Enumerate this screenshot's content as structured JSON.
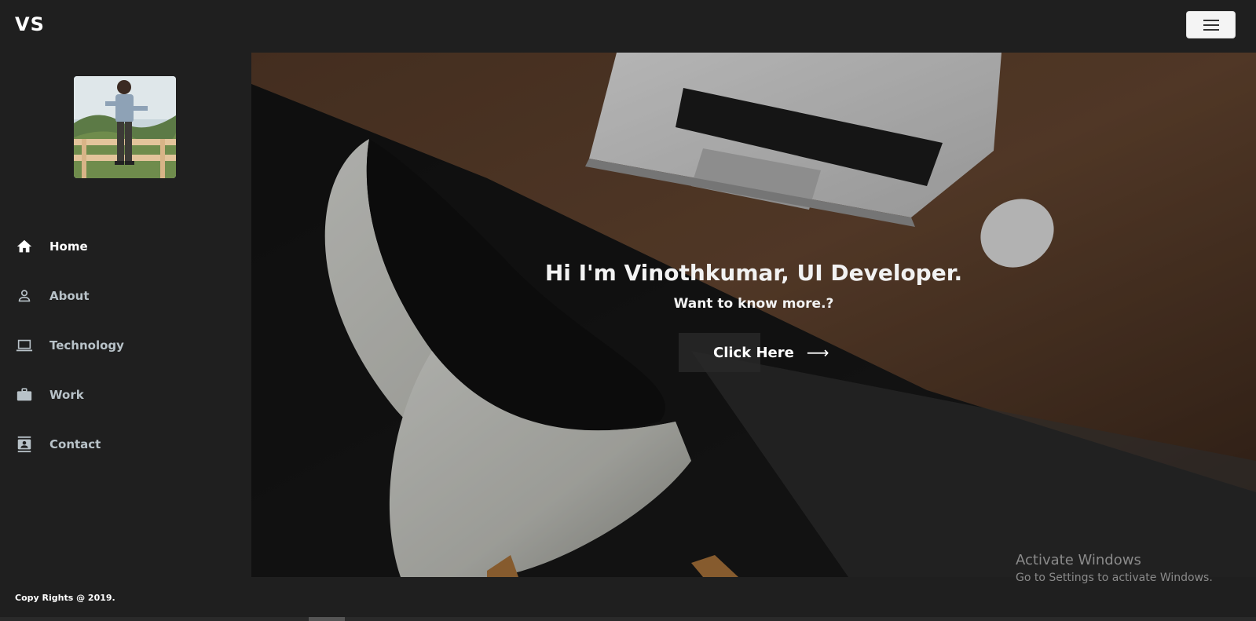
{
  "header": {
    "logo": "VS",
    "menu_icon": "hamburger-menu-icon"
  },
  "sidebar": {
    "avatar_alt": "profile-photo",
    "items": [
      {
        "label": "Home",
        "icon": "home-icon",
        "active": true
      },
      {
        "label": "About",
        "icon": "person-icon",
        "active": false
      },
      {
        "label": "Technology",
        "icon": "laptop-icon",
        "active": false
      },
      {
        "label": "Work",
        "icon": "briefcase-icon",
        "active": false
      },
      {
        "label": "Contact",
        "icon": "contact-card-icon",
        "active": false
      }
    ]
  },
  "hero": {
    "title": "Hi I'm Vinothkumar, UI Developer.",
    "subtitle": "Want to know more.?",
    "cta_label": "Click Here",
    "cta_arrow": "⟶"
  },
  "watermark": {
    "line1": "Activate Windows",
    "line2": "Go to Settings to activate Windows."
  },
  "footer": {
    "copyright": "Copy Rights @ 2019."
  },
  "colors": {
    "background": "#1f1f1f",
    "nav_inactive": "#b8c2c8",
    "nav_active": "#ffffff"
  }
}
